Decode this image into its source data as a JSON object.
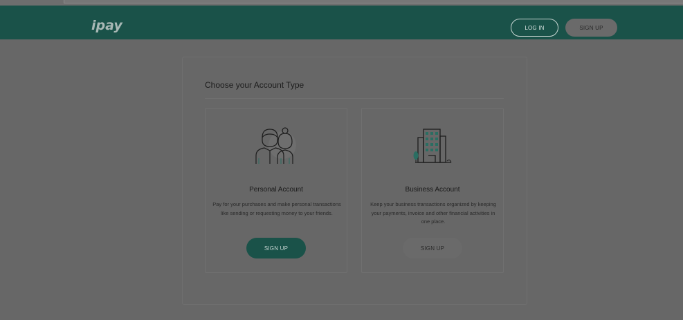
{
  "header": {
    "logo_text": "ipay",
    "login_label": "LOG IN",
    "signup_label": "SIGN UP"
  },
  "main": {
    "title": "Choose your Account Type",
    "accounts": [
      {
        "icon": "couple-icon",
        "title": "Personal Account",
        "description": "Pay for your purchases and make personal transactions like sending or requesting money to your friends.",
        "button_label": "SIGN UP"
      },
      {
        "icon": "office-building-icon",
        "title": "Business Account",
        "description": "Keep your business transactions organized by keeping your payments, invoice and other financial activities in one place.",
        "button_label": "SIGN UP"
      }
    ]
  },
  "colors": {
    "brand": "#1a5249",
    "overlay_bg": "#676767"
  }
}
